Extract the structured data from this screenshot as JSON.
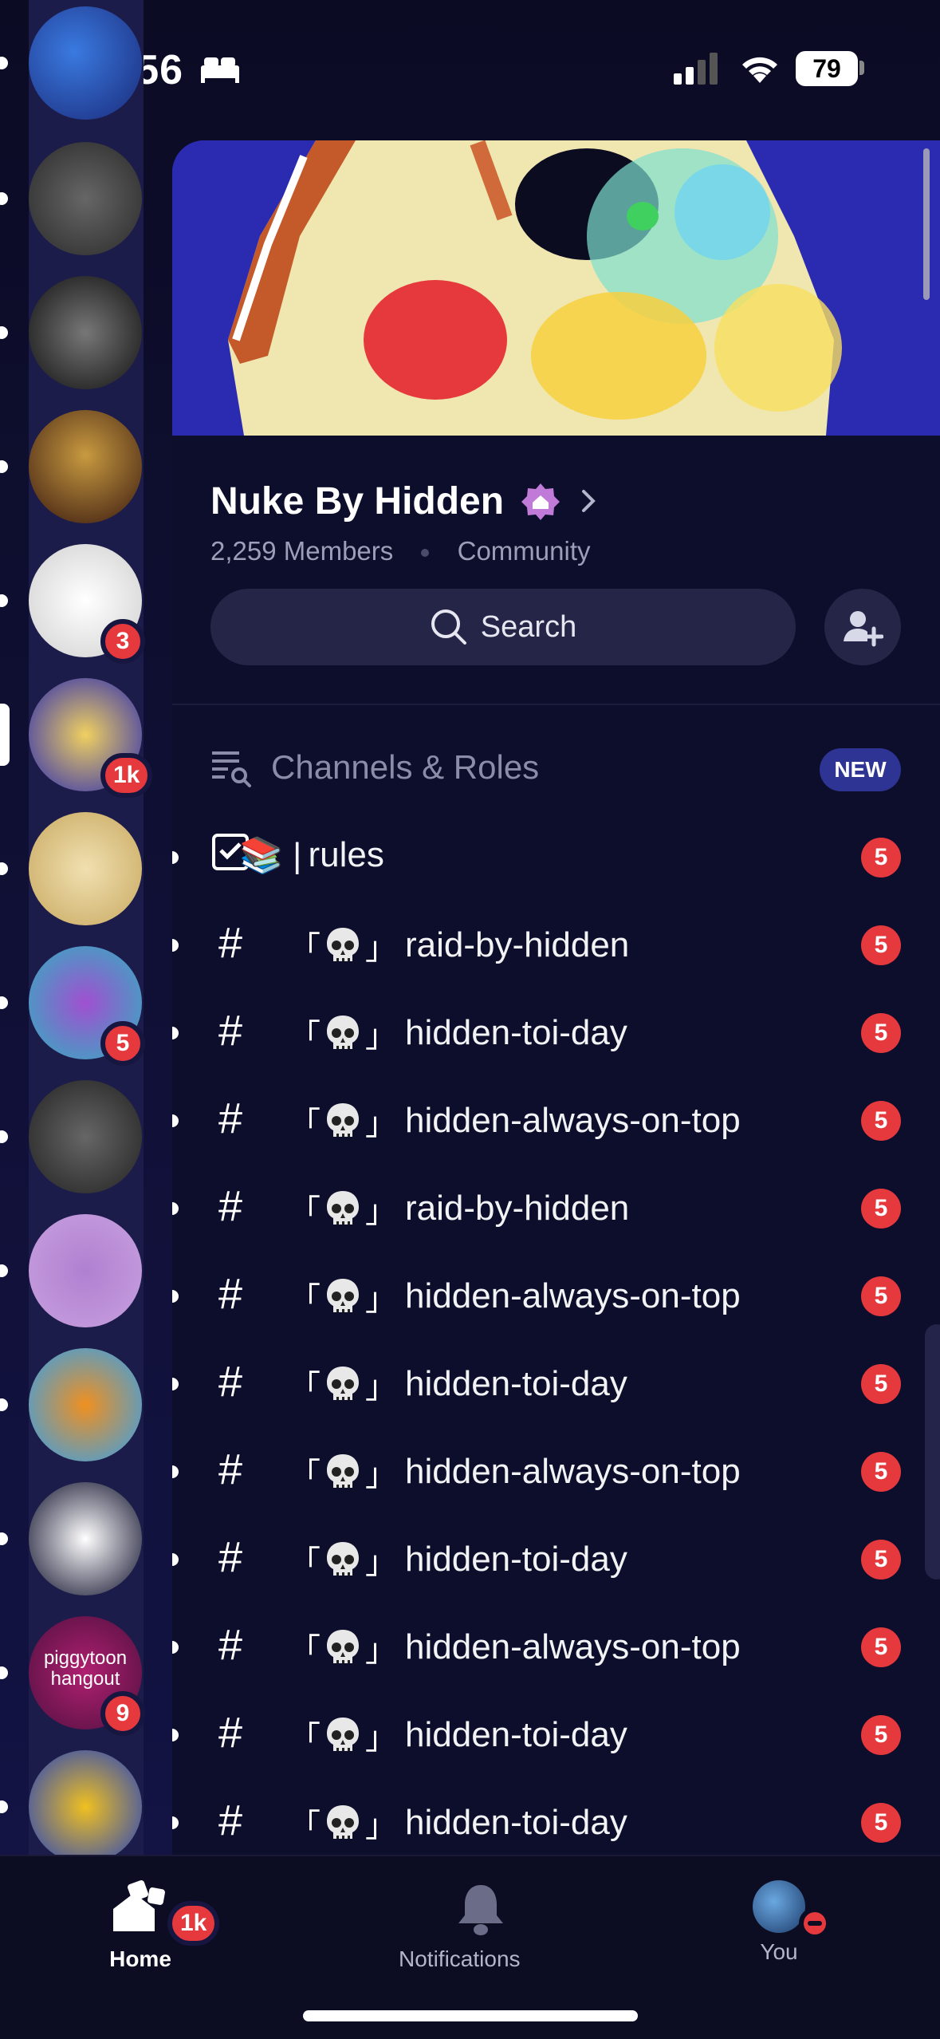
{
  "status_bar": {
    "time": "8:56",
    "battery": "79"
  },
  "server_rail": [
    {
      "name": "server-1",
      "badge": null
    },
    {
      "name": "server-2",
      "badge": null
    },
    {
      "name": "server-3",
      "badge": null
    },
    {
      "name": "server-4",
      "badge": null
    },
    {
      "name": "server-5",
      "badge": "3"
    },
    {
      "name": "nuke-by-hidden",
      "badge": "1k"
    },
    {
      "name": "server-7",
      "badge": null
    },
    {
      "name": "server-8",
      "badge": "5"
    },
    {
      "name": "server-9",
      "badge": null
    },
    {
      "name": "server-10",
      "badge": null
    },
    {
      "name": "server-11",
      "badge": null
    },
    {
      "name": "server-12",
      "badge": null
    },
    {
      "name": "piggytoon-hangout",
      "label": "piggytoon hangout",
      "badge": "9"
    },
    {
      "name": "server-14",
      "badge": null
    }
  ],
  "server": {
    "name": "Nuke By Hidden",
    "members": "2,259 Members",
    "type": "Community"
  },
  "search": {
    "label": "Search"
  },
  "channels_roles": {
    "label": "Channels & Roles",
    "new_label": "NEW"
  },
  "channels": [
    {
      "icon": "rules",
      "prefix": "📚 | ",
      "name": "rules",
      "badge": "5"
    },
    {
      "icon": "#",
      "name": "raid-by-hidden",
      "badge": "5"
    },
    {
      "icon": "#",
      "name": "hidden-toi-day",
      "badge": "5"
    },
    {
      "icon": "#",
      "name": "hidden-always-on-top",
      "badge": "5"
    },
    {
      "icon": "#",
      "name": "raid-by-hidden",
      "badge": "5"
    },
    {
      "icon": "#",
      "name": "hidden-always-on-top",
      "badge": "5"
    },
    {
      "icon": "#",
      "name": "hidden-toi-day",
      "badge": "5"
    },
    {
      "icon": "#",
      "name": "hidden-always-on-top",
      "badge": "5"
    },
    {
      "icon": "#",
      "name": "hidden-toi-day",
      "badge": "5"
    },
    {
      "icon": "#",
      "name": "hidden-always-on-top",
      "badge": "5"
    },
    {
      "icon": "#",
      "name": "hidden-toi-day",
      "badge": "5"
    },
    {
      "icon": "#",
      "name": "hidden-toi-day",
      "badge": "5"
    }
  ],
  "bottom_nav": {
    "home": {
      "label": "Home",
      "badge": "1k"
    },
    "notifications": {
      "label": "Notifications"
    },
    "you": {
      "label": "You"
    }
  },
  "colors": {
    "accent": "#2d3494",
    "badge_red": "#e5393d",
    "background": "#0d0d2c"
  }
}
